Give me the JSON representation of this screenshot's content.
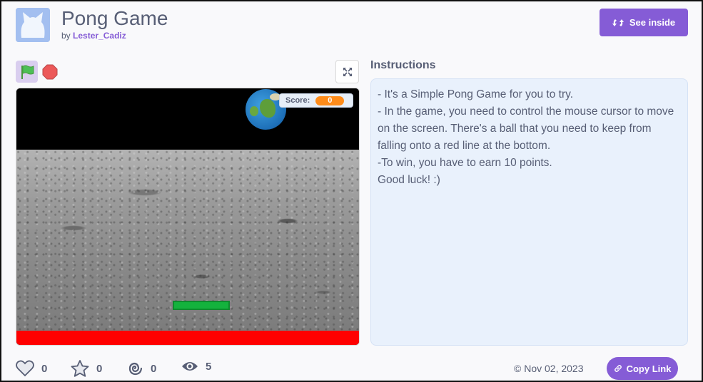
{
  "project": {
    "title": "Pong Game",
    "by_label": "by",
    "author": "Lester_Cadiz"
  },
  "header": {
    "see_inside_label": "See inside"
  },
  "stage": {
    "score_label": "Score:",
    "score_value": "0"
  },
  "instructions": {
    "heading": "Instructions",
    "lines": [
      "- It's a Simple Pong Game for you to try.",
      "- In the game, you need to control the mouse cursor to move on the screen. There's a ball that you need to keep from falling onto a red line at the bottom.",
      "-To win, you have to earn 10 points.",
      "Good luck! :)"
    ]
  },
  "stats": {
    "loves": "0",
    "favorites": "0",
    "remixes": "0",
    "views": "5"
  },
  "footer": {
    "date": "© Nov 02, 2023",
    "copy_link_label": "Copy Link"
  },
  "colors": {
    "accent": "#855cd6",
    "text": "#575e75",
    "paddle": "#14b23d",
    "red_line": "#ff0000",
    "score_badge": "#ff8c1a"
  },
  "icons": {
    "flag": "green-flag-icon",
    "stop": "stop-icon",
    "fullscreen": "fullscreen-icon",
    "see_inside": "remix-arrows-icon",
    "love": "heart-icon",
    "favorite": "star-icon",
    "remix": "spiral-icon",
    "views": "eye-icon",
    "copy_link": "link-icon"
  }
}
